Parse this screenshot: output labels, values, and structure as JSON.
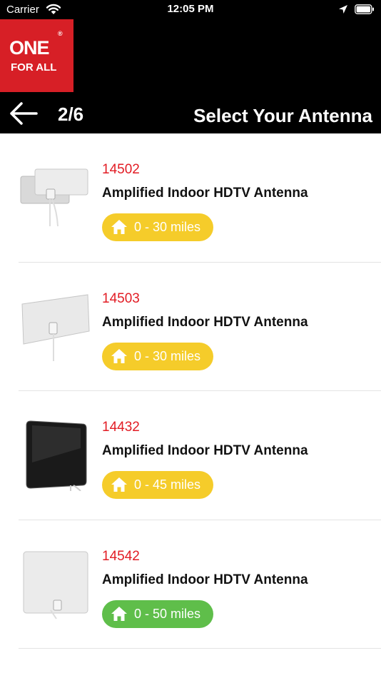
{
  "status_bar": {
    "carrier": "Carrier",
    "time": "12:05 PM"
  },
  "logo": {
    "line1": "ONE",
    "line2": "FOR ALL",
    "registered": "®"
  },
  "nav": {
    "step": "2/6",
    "title": "Select Your Antenna"
  },
  "colors": {
    "brand_red": "#d71f26",
    "badge_yellow": "#f5cc2a",
    "badge_green": "#5fbe4a"
  },
  "antennas": [
    {
      "model": "14502",
      "name": "Amplified Indoor HDTV Antenna",
      "range": "0 - 30 miles",
      "badge_color": "yellow"
    },
    {
      "model": "14503",
      "name": "Amplified Indoor HDTV Antenna",
      "range": "0 - 30 miles",
      "badge_color": "yellow"
    },
    {
      "model": "14432",
      "name": "Amplified Indoor HDTV Antenna",
      "range": "0 - 45 miles",
      "badge_color": "yellow"
    },
    {
      "model": "14542",
      "name": "Amplified Indoor HDTV Antenna",
      "range": "0 - 50 miles",
      "badge_color": "green"
    }
  ]
}
